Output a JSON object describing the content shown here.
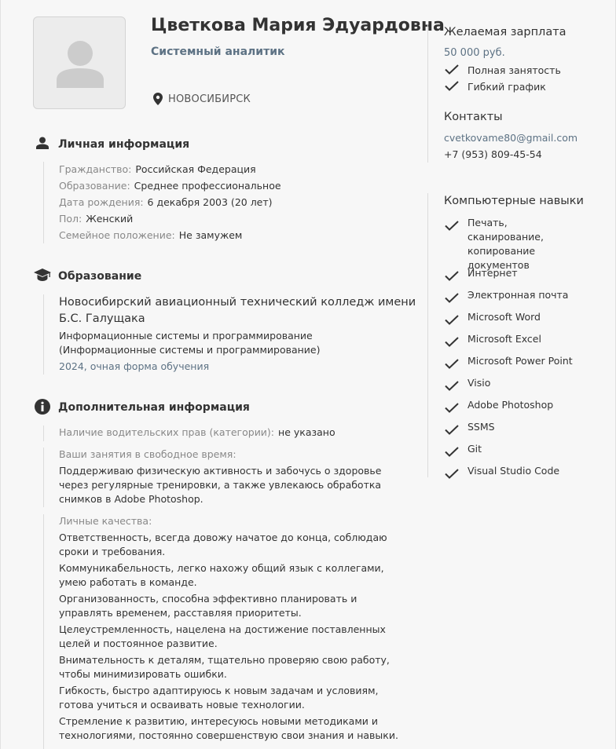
{
  "header": {
    "name": "Цветкова Мария Эдуардовна",
    "position": "Системный аналитик",
    "city": "НОВОСИБИРСК"
  },
  "personal": {
    "title": "Личная информация",
    "fields": [
      {
        "key": "Гражданство:",
        "value": "Российская Федерация"
      },
      {
        "key": "Образование:",
        "value": "Среднее профессиональное"
      },
      {
        "key": "Дата рождения:",
        "value": "6 декабря 2003 (20 лет)"
      },
      {
        "key": "Пол:",
        "value": "Женский"
      },
      {
        "key": "Семейное положение:",
        "value": "Не замужем"
      }
    ]
  },
  "education": {
    "title": "Образование",
    "institution": "Новосибирский авиационный технический колледж имени Б.С. Галущака",
    "specialty": "Информационные системы и программирование (Информационные системы и программирование)",
    "year_form": "2024, очная форма обучения"
  },
  "additional": {
    "title": "Дополнительная информация",
    "license_label": "Наличие водительских прав (категории):",
    "license_value": "не указано",
    "hobbies_label": "Ваши занятия в свободное время:",
    "hobbies_text": "Поддерживаю физическую активность и забочусь о здоровье через регулярные тренировки, а также увлекаюсь обработка снимков в Adobe Photoshop.",
    "qualities_label": "Личные качества:",
    "qualities": [
      "Ответственность, всегда довожу начатое до конца, соблюдаю сроки и требования.",
      "Коммуникабельность, легко нахожу общий язык с коллегами, умею работать в команде.",
      "Организованность, способна эффективно планировать и управлять временем, расставляя приоритеты.",
      "Целеустремленность, нацелена на достижение поставленных целей и постоянное развитие.",
      "Внимательность к деталям, тщательно проверяю свою работу, чтобы минимизировать ошибки.",
      "Гибкость, быстро адаптируюсь к новым задачам и условиям, готова учиться и осваивать новые технологии.",
      "Стремление к развитию, интересуюсь новыми методиками и технологиями, постоянно совершенствую свои знания и навыки."
    ]
  },
  "salary": {
    "title": "Желаемая зарплата",
    "amount": "50 000 руб.",
    "conditions": [
      "Полная занятость",
      "Гибкий график"
    ]
  },
  "contacts": {
    "title": "Контакты",
    "email": "cvetkovame80@gmail.com",
    "phone": "+7 (953) 809-45-54"
  },
  "skills": {
    "title": "Компьютерные навыки",
    "items": [
      "Печать, сканирование, копирование документов",
      "Интернет",
      "Электронная почта",
      "Microsoft Word",
      "Microsoft Excel",
      "Microsoft Power Point",
      "Visio",
      "Adobe Photoshop",
      "SSMS",
      "Git",
      "Visual Studio Code"
    ]
  },
  "colors": {
    "accent": "#5d7284",
    "text": "#333333",
    "muted": "#888888",
    "background": "#f7f7f7"
  }
}
